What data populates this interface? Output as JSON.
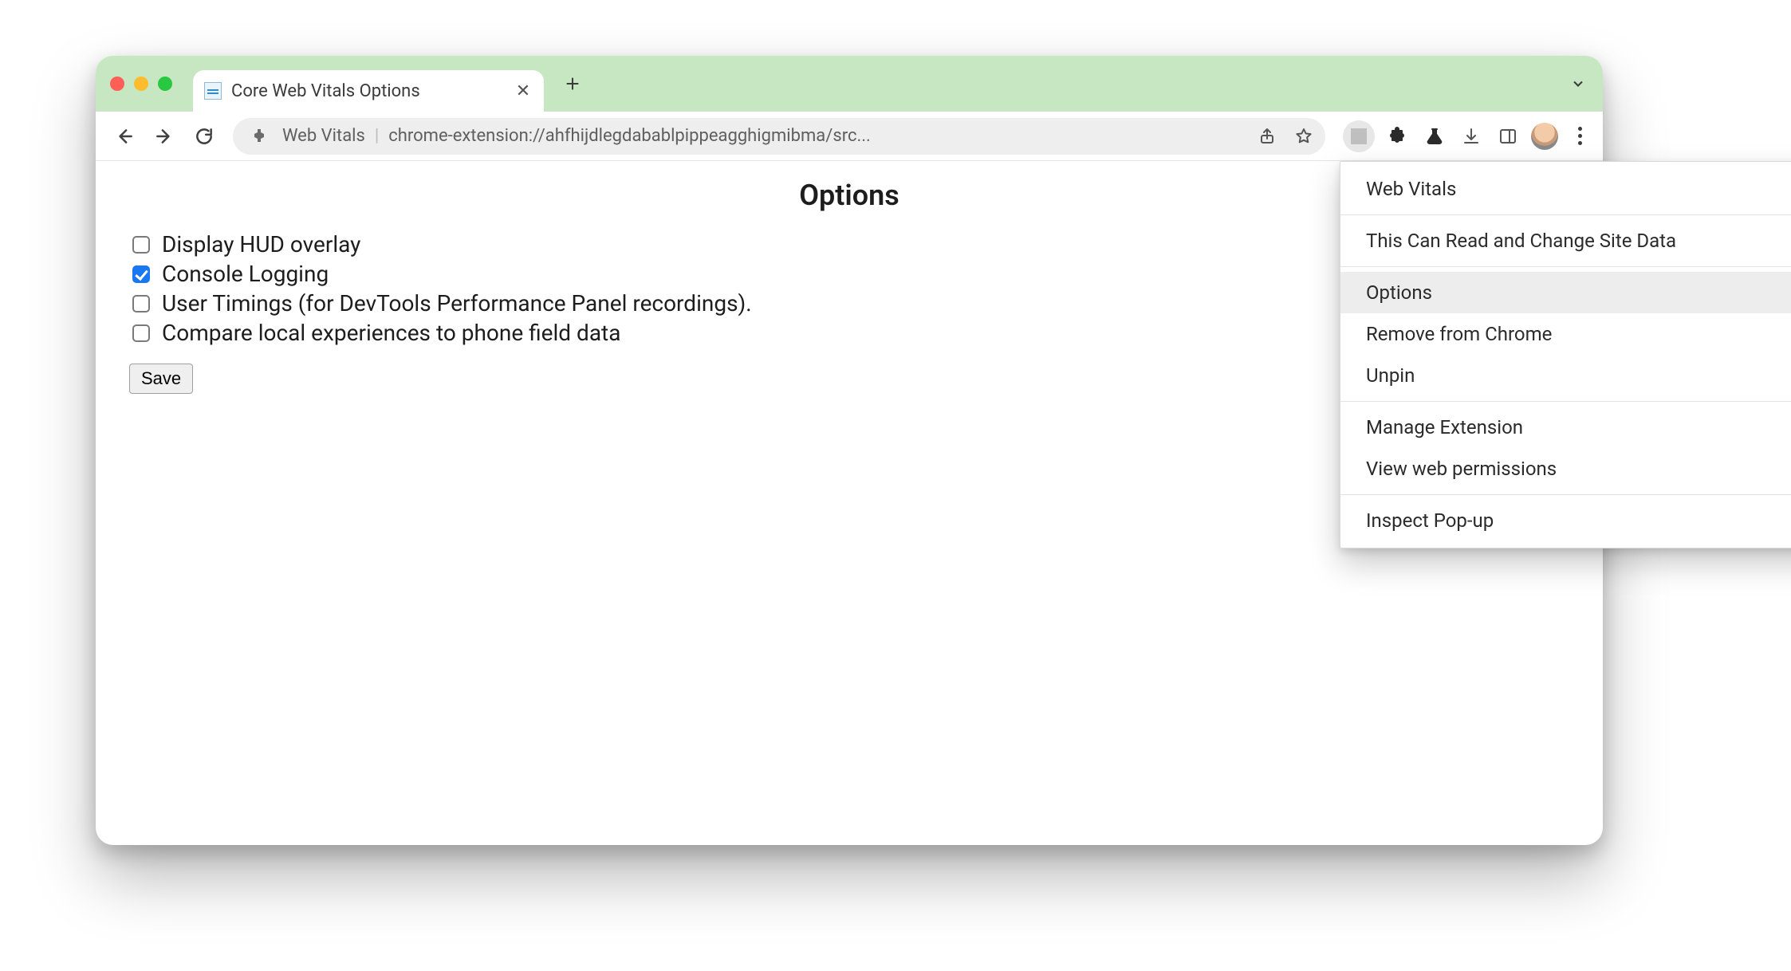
{
  "tab": {
    "title": "Core Web Vitals Options"
  },
  "omnibox": {
    "extension_name": "Web Vitals",
    "url": "chrome-extension://ahfhijdlegdabablpippeagghigmibma/src..."
  },
  "page": {
    "heading": "Options",
    "options": [
      {
        "label": "Display HUD overlay",
        "checked": false
      },
      {
        "label": "Console Logging",
        "checked": true
      },
      {
        "label": "User Timings (for DevTools Performance Panel recordings).",
        "checked": false
      },
      {
        "label": "Compare local experiences to phone field data",
        "checked": false
      }
    ],
    "save_label": "Save"
  },
  "context_menu": {
    "title": "Web Vitals",
    "items": [
      {
        "label": "This Can Read and Change Site Data",
        "submenu": true
      },
      "sep",
      {
        "label": "Options",
        "hover": true
      },
      {
        "label": "Remove from Chrome"
      },
      {
        "label": "Unpin"
      },
      "sep",
      {
        "label": "Manage Extension"
      },
      {
        "label": "View web permissions"
      },
      "sep",
      {
        "label": "Inspect Pop-up"
      }
    ]
  }
}
